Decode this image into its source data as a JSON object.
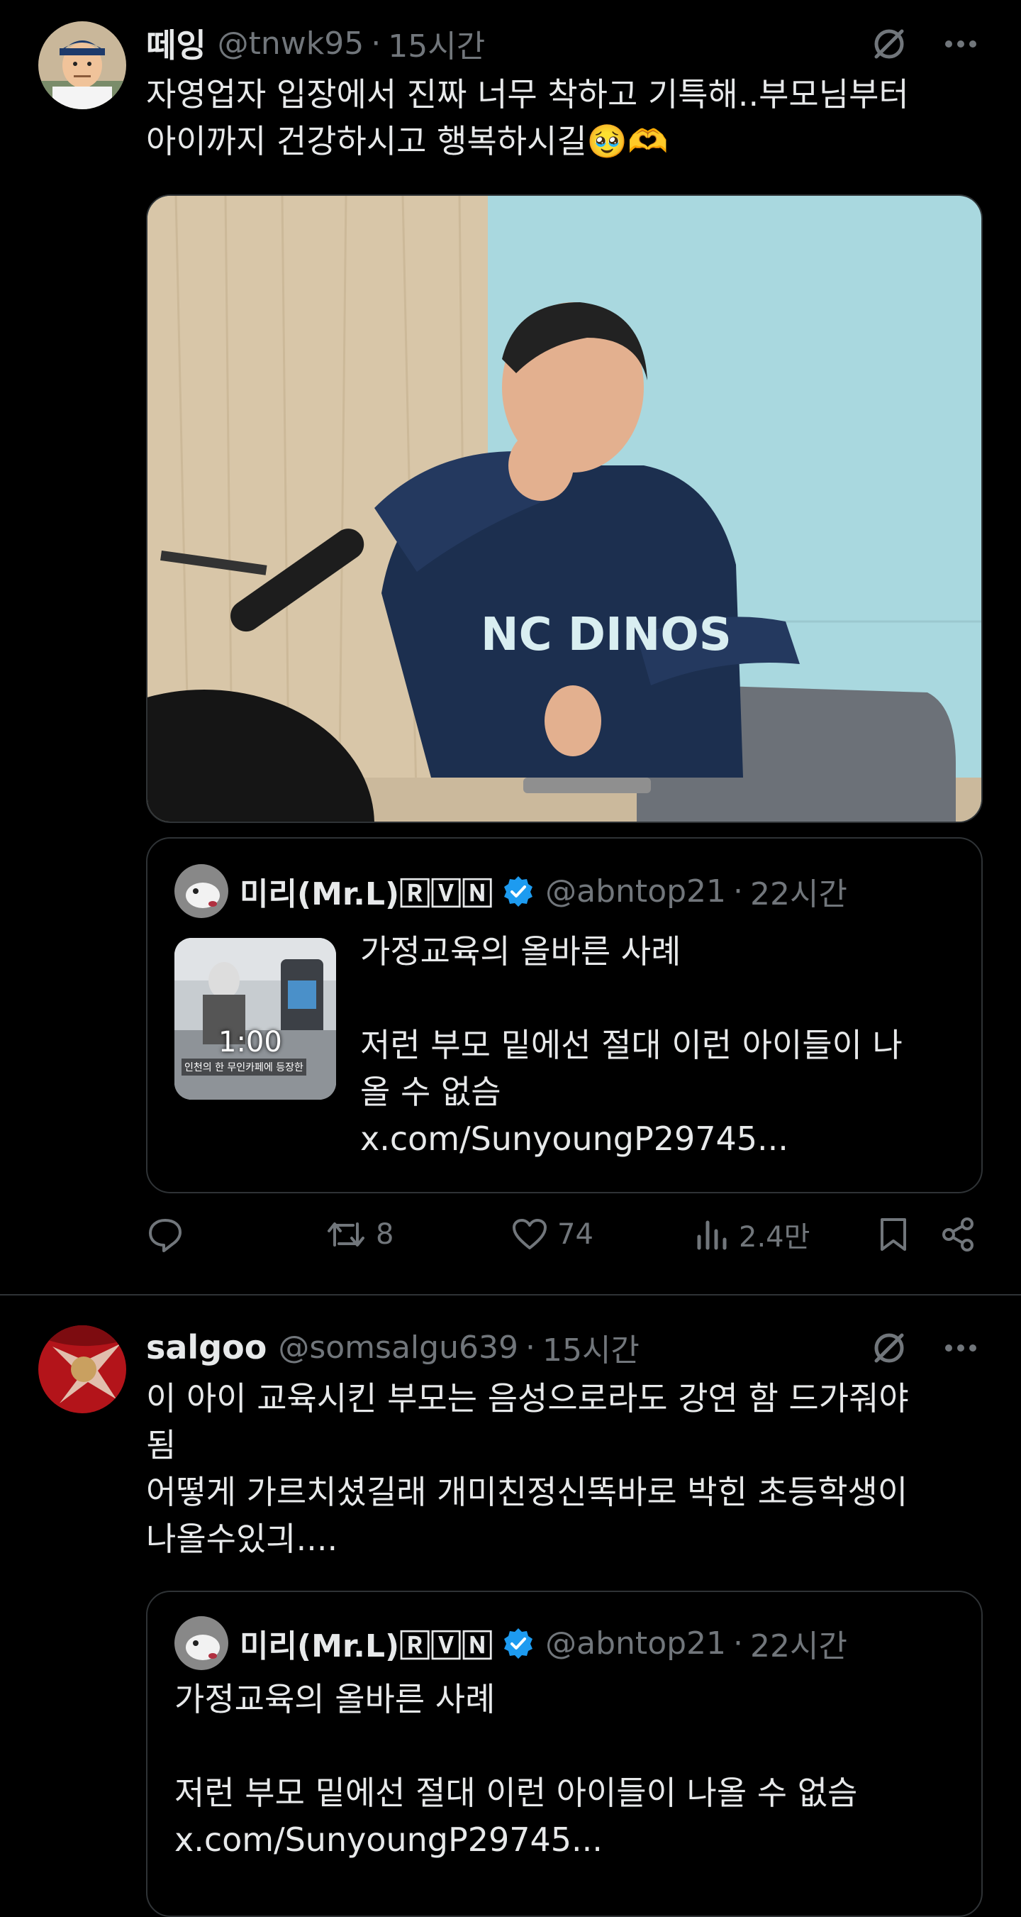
{
  "colors": {
    "background": "#000000",
    "text": "#e7e9ea",
    "muted": "#71767b",
    "verified": "#1d9bf0",
    "border": "#2f3336"
  },
  "tweets": [
    {
      "author": {
        "name": "떼잉",
        "handle": "@tnwk95",
        "time": "15시간"
      },
      "text": "자영업자 입장에서 진짜 너무 착하고 기특해..부모님부터\n아이까지 건강하시고 행복하시길🥹🫶",
      "quote": {
        "author": {
          "name": "미리(Mr.L)🅁🅅🄽",
          "handle": "@abntop21",
          "time": "22시간"
        },
        "text": "가정교육의 올바른 사례\n\n저런 부모 밑에선 절대 이런 아이들이 나\n올 수 없슴\nx.com/SunyoungP29745...",
        "video_duration": "1:00",
        "thumb_caption": "인천의 한 무인카페에 등장한"
      },
      "stats": {
        "replies": "",
        "reposts": "8",
        "likes": "74",
        "views": "2.4만"
      }
    },
    {
      "author": {
        "name": "salgoo",
        "handle": "@somsalgu639",
        "time": "15시간"
      },
      "text": "이 아이 교육시킨 부모는 음성으로라도 강연 함 드가줘야\n됨\n어떻게 가르치셨길래 개미친정신똑바로 박힌 초등학생이\n나올수있긔....",
      "quote": {
        "author": {
          "name": "미리(Mr.L)🅁🅅🄽",
          "handle": "@abntop21",
          "time": "22시간"
        },
        "text": "가정교육의 올바른 사례\n\n저런 부모 밑에선 절대 이런 아이들이 나올 수 없슴\nx.com/SunyoungP29745..."
      }
    }
  ],
  "icons": [
    "grok-icon",
    "more-icon",
    "reply-icon",
    "repost-icon",
    "like-icon",
    "views-icon",
    "bookmark-icon",
    "share-icon",
    "verified-icon"
  ]
}
